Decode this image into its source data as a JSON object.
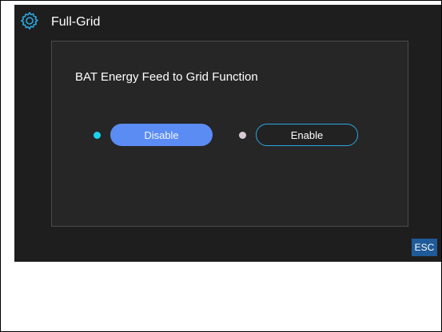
{
  "header": {
    "title": "Full-Grid",
    "icon": "gear-icon",
    "icon_color": "#2aa8e0"
  },
  "panel": {
    "label": "BAT Energy Feed to Grid Function",
    "options": [
      {
        "label": "Disable",
        "selected": true,
        "dot_color": "#19d3ef"
      },
      {
        "label": "Enable",
        "selected": false,
        "dot_color": "#d8c9d6"
      }
    ]
  },
  "footer": {
    "esc_label": "ESC"
  },
  "colors": {
    "screen_background": "#1e1e1e",
    "accent": "#2aa8e0",
    "selected_button": "#5b8cf4",
    "esc_background": "#1f5a99"
  }
}
